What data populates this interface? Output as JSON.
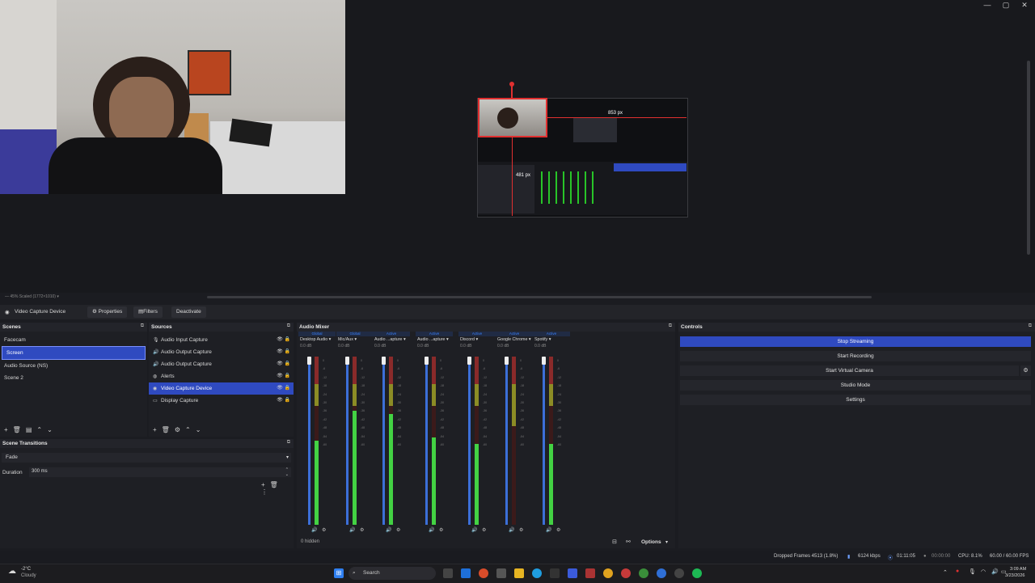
{
  "preview": {
    "window_controls": [
      "—",
      "▢",
      "✕"
    ],
    "measure_h": "853 px",
    "measure_v": "481 px",
    "zoom_text": "—  45%    Scaled (1772×1010)  ▾"
  },
  "context_bar": {
    "source_name": "Video Capture Device",
    "properties_label": "Properties",
    "filters_label": "Filters",
    "deactivate_label": "Deactivate"
  },
  "scenes": {
    "title": "Scenes",
    "items": [
      "Facecam",
      "Screen",
      "Audio Source (NS)",
      "Scene 2"
    ],
    "selected": "Screen"
  },
  "sources": {
    "title": "Sources",
    "items": [
      {
        "label": "Audio Input Capture",
        "icon": "mic-icon"
      },
      {
        "label": "Audio Output Capture",
        "icon": "speaker-icon"
      },
      {
        "label": "Audio Output Capture",
        "icon": "speaker-icon"
      },
      {
        "label": "Alerts",
        "icon": "browser-icon"
      },
      {
        "label": "Video Capture Device",
        "icon": "camera-icon"
      },
      {
        "label": "Display Capture",
        "icon": "monitor-icon"
      }
    ],
    "selected": "Video Capture Device"
  },
  "transitions": {
    "title": "Scene Transitions",
    "type": "Fade",
    "duration_label": "Duration",
    "duration_value": "300 ms"
  },
  "mixer": {
    "title": "Audio Mixer",
    "channels": [
      {
        "badge": "Global",
        "name": "Desktop Audio",
        "db": "0.0 dB"
      },
      {
        "badge": "Global",
        "name": "Mic/Aux",
        "db": "0.0 dB"
      },
      {
        "badge": "Active",
        "name": "Audio ...apture",
        "db": "0.0 dB"
      },
      {
        "badge": "Active",
        "name": "Audio ...apture",
        "db": "0.0 dB"
      },
      {
        "badge": "Active",
        "name": "Discord",
        "db": "0.0 dB"
      },
      {
        "badge": "Active",
        "name": "Google Chrome",
        "db": "0.0 dB"
      },
      {
        "badge": "Active",
        "name": "Spotify",
        "db": "0.0 dB"
      }
    ],
    "tick_labels": [
      "0",
      "-6",
      "-12",
      "-18",
      "-24",
      "-30",
      "-36",
      "-42",
      "-48",
      "-54",
      "-60"
    ],
    "hidden_label": "0 hidden",
    "options_label": "Options"
  },
  "controls": {
    "title": "Controls",
    "buttons": [
      "Stop Streaming",
      "Start Recording",
      "Start Virtual Camera",
      "Studio Mode",
      "Settings"
    ]
  },
  "status": {
    "dropped": "Dropped Frames 4513 (1.8%)",
    "kbps": "6124 kbps",
    "stream_time": "01:11:05",
    "rec_time": "00:00:00",
    "cpu": "CPU: 8.1%",
    "fps": "60.00 / 60.00 FPS"
  },
  "taskbar": {
    "weather_temp": "-2°C",
    "weather_desc": "Cloudy",
    "search_label": "Search",
    "time": "3:09 AM",
    "date": "3/23/2026"
  }
}
